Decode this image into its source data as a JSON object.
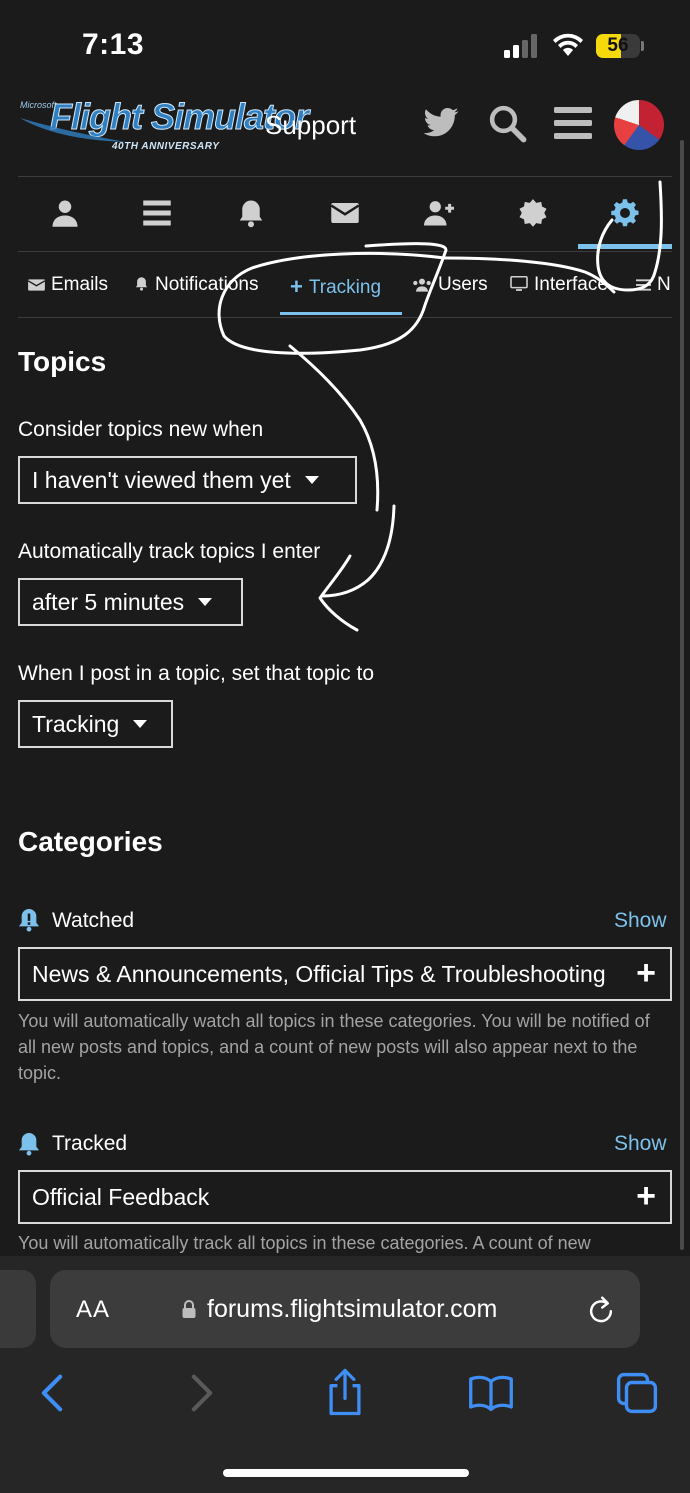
{
  "status_bar": {
    "time": "7:13",
    "battery": "56",
    "battery_level_percent": 56
  },
  "header": {
    "logo_small": "Microsoft",
    "logo_main": "Flight Simulator",
    "logo_sub": "40TH ANNIVERSARY",
    "support_label": "Support"
  },
  "tabs": [
    {
      "label": "Emails"
    },
    {
      "label": "Notifications"
    },
    {
      "label": "Tracking"
    },
    {
      "label": "Users"
    },
    {
      "label": "Interface"
    },
    {
      "label": "N"
    }
  ],
  "topics": {
    "heading": "Topics",
    "new_when_label": "Consider topics new when",
    "new_when_value": "I haven't viewed them yet",
    "auto_track_label": "Automatically track topics I enter",
    "auto_track_value": "after 5 minutes",
    "post_label": "When I post in a topic, set that topic to",
    "post_value": "Tracking"
  },
  "categories": {
    "heading": "Categories",
    "watched": {
      "label": "Watched",
      "show": "Show",
      "value": "News & Announcements, Official Tips & Troubleshooting",
      "description": "You will automatically watch all topics in these categories. You will be notified of all new posts and topics, and a count of new posts will also appear next to the topic."
    },
    "tracked": {
      "label": "Tracked",
      "show": "Show",
      "value": "Official Feedback",
      "description": "You will automatically track all topics in these categories. A count of new"
    }
  },
  "safari": {
    "aa_label": "AA",
    "url": "forums.flightsimulator.com"
  },
  "colors": {
    "accent": "#7cc1ec",
    "background": "#1b1b1b",
    "annotation": "#ffffff"
  }
}
